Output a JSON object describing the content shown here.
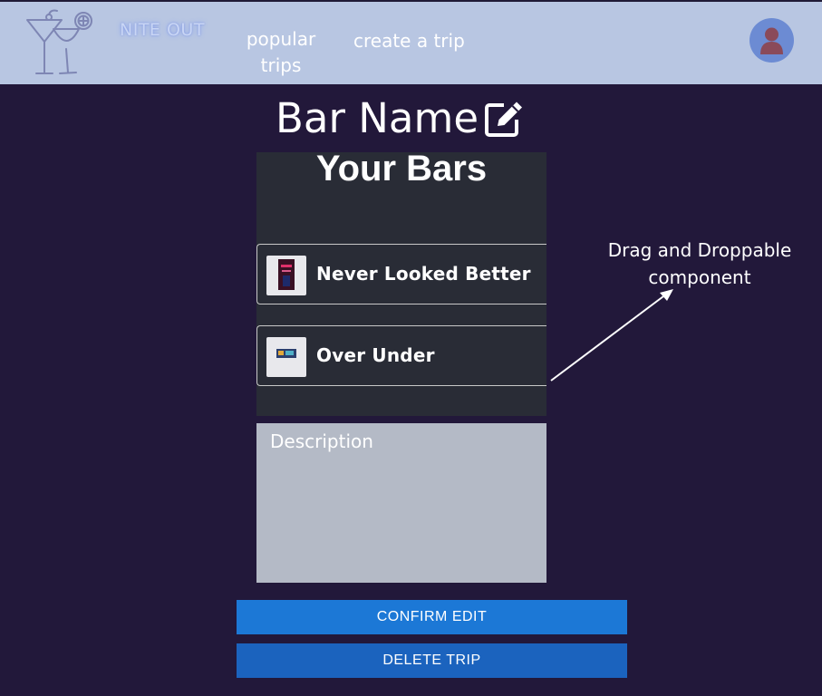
{
  "header": {
    "brand": "NITE OUT",
    "nav": [
      {
        "label": "popular trips"
      },
      {
        "label": "create a trip"
      }
    ],
    "icons": {
      "logo": "cocktail-glasses-icon",
      "avatar": "user-icon"
    }
  },
  "main": {
    "title": "Bar Name",
    "edit_icon": "edit-icon",
    "bars_heading": "Your Bars",
    "bars": [
      {
        "name": "Never Looked Better"
      },
      {
        "name": "Over Under"
      }
    ],
    "description_placeholder": "Description",
    "confirm_label": "CONFIRM EDIT",
    "delete_label": "DELETE TRIP"
  },
  "annotation": {
    "text": "Drag and Droppable component"
  },
  "colors": {
    "background": "#22183a",
    "header": "#b8c6e2",
    "panel": "#292c36",
    "description": "#b4bac6",
    "confirm_button": "#1c78d6",
    "delete_button": "#1b63be"
  }
}
